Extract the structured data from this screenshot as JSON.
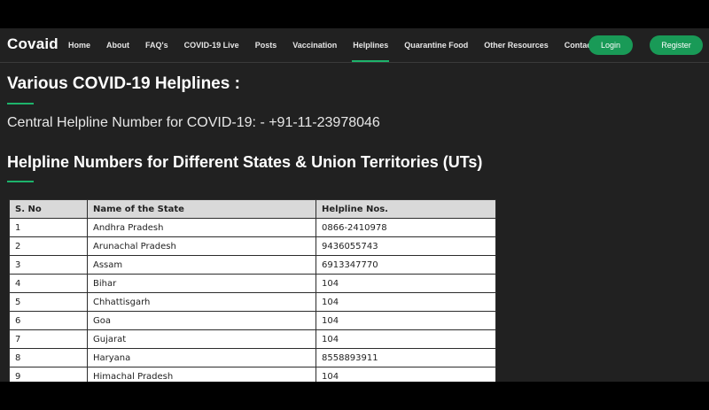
{
  "brand": "Covaid",
  "nav": {
    "links": [
      "Home",
      "About",
      "FAQ's",
      "COVID-19 Live",
      "Posts",
      "Vaccination",
      "Helplines",
      "Quarantine Food",
      "Other Resources",
      "Contact"
    ],
    "active": "Helplines",
    "login": "Login",
    "register": "Register"
  },
  "colors": {
    "accent": "#1db36b",
    "button": "#199a57",
    "background": "#212121"
  },
  "main": {
    "title": "Various COVID-19 Helplines :",
    "central_helpline": "Central Helpline Number for COVID-19: - +91-11-23978046",
    "states_title": "Helpline Numbers for Different States & Union Territories (UTs)"
  },
  "table": {
    "headers": [
      "S. No",
      "Name of the State",
      "Helpline Nos."
    ],
    "rows": [
      [
        "1",
        "Andhra Pradesh",
        "0866-2410978"
      ],
      [
        "2",
        "Arunachal Pradesh",
        "9436055743"
      ],
      [
        "3",
        "Assam",
        "6913347770"
      ],
      [
        "4",
        "Bihar",
        "104"
      ],
      [
        "5",
        "Chhattisgarh",
        "104"
      ],
      [
        "6",
        "Goa",
        "104"
      ],
      [
        "7",
        "Gujarat",
        "104"
      ],
      [
        "8",
        "Haryana",
        "8558893911"
      ],
      [
        "9",
        "Himachal Pradesh",
        "104"
      ]
    ]
  }
}
